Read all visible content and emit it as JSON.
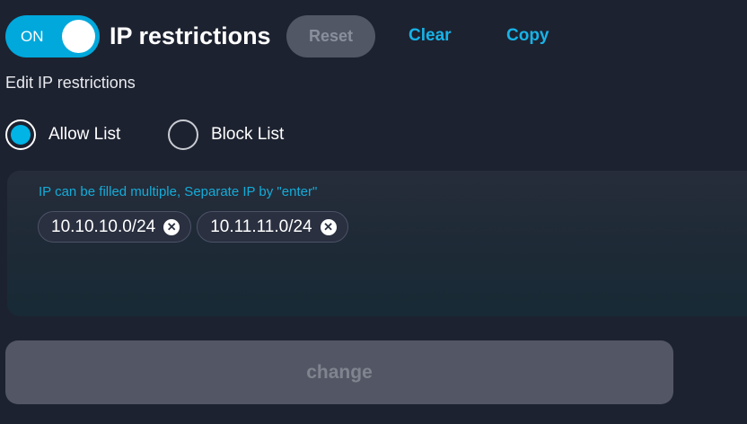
{
  "header": {
    "toggle_label": "ON",
    "toggle_state": "on",
    "title": "IP restrictions",
    "reset_label": "Reset",
    "clear_label": "Clear",
    "copy_label": "Copy"
  },
  "subtitle": "Edit IP restrictions",
  "list_type": {
    "selected": "Allow List",
    "options": [
      {
        "label": "Allow List",
        "selected": true
      },
      {
        "label": "Block List",
        "selected": false
      }
    ]
  },
  "ip_input": {
    "hint": "IP can be filled multiple, Separate IP by \"enter\"",
    "tags": [
      {
        "value": "10.10.10.0/24",
        "remove_icon": "close-circle-icon"
      },
      {
        "value": "10.11.11.0/24",
        "remove_icon": "close-circle-icon"
      }
    ]
  },
  "change_label": "change",
  "colors": {
    "background": "#1d2230",
    "accent": "#00a8dc",
    "link": "#17b3e8",
    "disabled_button": "#535765"
  }
}
